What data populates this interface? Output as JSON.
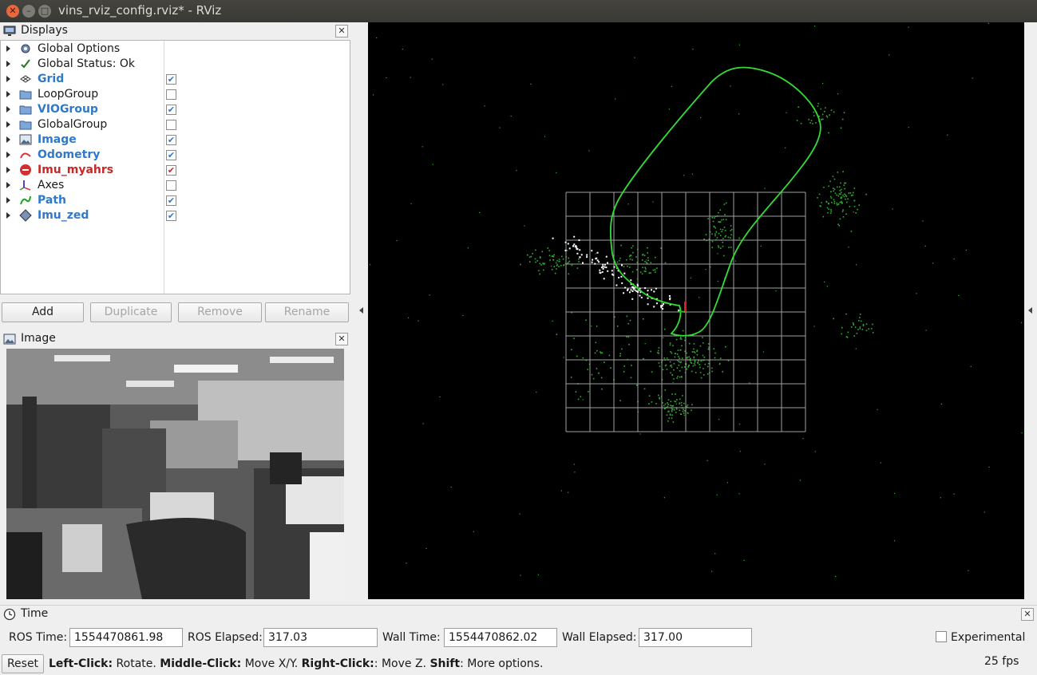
{
  "window": {
    "title": "vins_rviz_config.rviz* - RViz"
  },
  "displays_panel": {
    "title": "Displays",
    "items": [
      {
        "label": "Global Options",
        "icon": "gear-icon",
        "checked": null,
        "style": "normal"
      },
      {
        "label": "Global Status: Ok",
        "icon": "checkmark-icon",
        "checked": null,
        "style": "normal"
      },
      {
        "label": "Grid",
        "icon": "grid-icon",
        "checked": true,
        "style": "blue"
      },
      {
        "label": "LoopGroup",
        "icon": "folder-icon",
        "checked": false,
        "style": "normal"
      },
      {
        "label": "VIOGroup",
        "icon": "folder-icon",
        "checked": true,
        "style": "blue"
      },
      {
        "label": "GlobalGroup",
        "icon": "folder-icon",
        "checked": false,
        "style": "normal"
      },
      {
        "label": "Image",
        "icon": "image-icon",
        "checked": true,
        "style": "blue"
      },
      {
        "label": "Odometry",
        "icon": "odometry-icon",
        "checked": true,
        "style": "blue"
      },
      {
        "label": "Imu_myahrs",
        "icon": "error-icon",
        "checked": true,
        "style": "red"
      },
      {
        "label": "Axes",
        "icon": "axes-icon",
        "checked": false,
        "style": "normal"
      },
      {
        "label": "Path",
        "icon": "path-icon",
        "checked": true,
        "style": "blue"
      },
      {
        "label": "Imu_zed",
        "icon": "imu-icon",
        "checked": true,
        "style": "blue"
      }
    ],
    "buttons": {
      "add": "Add",
      "duplicate": "Duplicate",
      "remove": "Remove",
      "rename": "Rename"
    }
  },
  "image_panel": {
    "title": "Image"
  },
  "time_panel": {
    "title": "Time",
    "ros_time_label": "ROS Time:",
    "ros_time_value": "1554470861.98",
    "ros_elapsed_label": "ROS Elapsed:",
    "ros_elapsed_value": "317.03",
    "wall_time_label": "Wall Time:",
    "wall_time_value": "1554470862.02",
    "wall_elapsed_label": "Wall Elapsed:",
    "wall_elapsed_value": "317.00",
    "experimental_label": "Experimental",
    "experimental_checked": false
  },
  "status_bar": {
    "reset_label": "Reset",
    "left_click_key": "Left-Click:",
    "left_click_action": " Rotate. ",
    "middle_click_key": "Middle-Click:",
    "middle_click_action": " Move X/Y. ",
    "right_click_key": "Right-Click:",
    "right_click_action": ": Move Z. ",
    "shift_key": "Shift",
    "shift_action": ": More options.",
    "fps": "25 fps"
  },
  "colors": {
    "path": "#33dd33",
    "grid": "#a0a0a0",
    "points_white": "#ffffff",
    "points_green": "#2fae2f",
    "blue_label": "#2f79c8",
    "error_red": "#c62828"
  }
}
